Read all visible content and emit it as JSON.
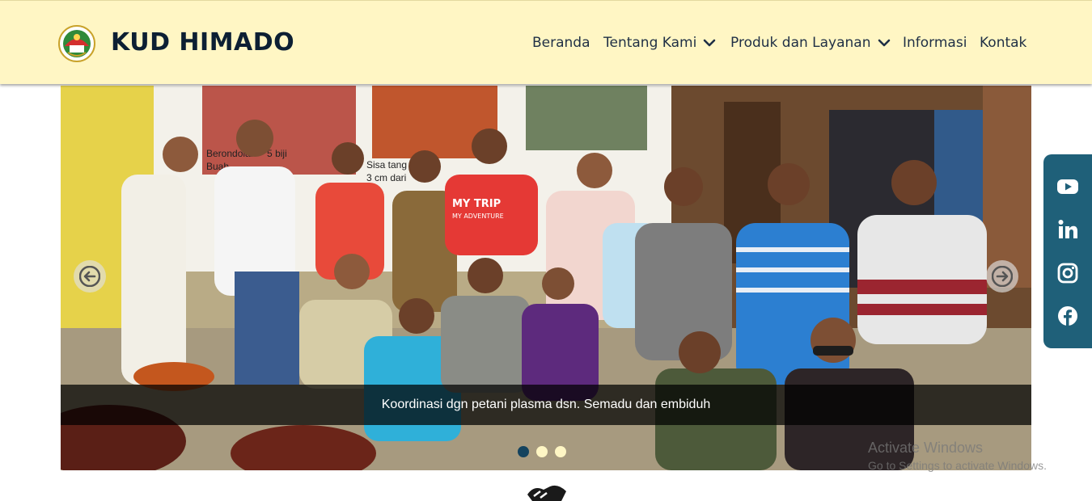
{
  "brand": {
    "name": "KUD HIMADO",
    "logo": "cooperative-logo"
  },
  "nav": {
    "items": [
      {
        "label": "Beranda",
        "has_dropdown": false
      },
      {
        "label": "Tentang Kami",
        "has_dropdown": true,
        "icon": "chevron-down-icon"
      },
      {
        "label": "Produk dan Layanan",
        "has_dropdown": true,
        "icon": "chevron-down-icon"
      },
      {
        "label": "Informasi",
        "has_dropdown": false
      },
      {
        "label": "Kontak",
        "has_dropdown": false
      }
    ]
  },
  "slider": {
    "caption": "Koordinasi dgn petani plasma dsn. Semadu dan embiduh",
    "prev_icon": "arrow-left-icon",
    "next_icon": "arrow-right-icon",
    "slide_count": 3,
    "active_index": 0,
    "banner_text": [
      "Berondolan > 5 biji",
      "Buah",
      "Sisa tang",
      "3 cm dari",
      "MY TRIP",
      "MY ADVENTURE"
    ]
  },
  "social": [
    {
      "name": "youtube-icon"
    },
    {
      "name": "linkedin-icon"
    },
    {
      "name": "instagram-icon"
    },
    {
      "name": "facebook-icon"
    }
  ],
  "watermark": {
    "title": "Activate Windows",
    "subtitle": "Go to Settings to activate Windows."
  },
  "colors": {
    "navbar": "#fff6c4",
    "brand_text": "#0c1f33",
    "social_bar": "#1f6079",
    "dot_active": "#14435e",
    "dot_inactive": "#fff6c4"
  }
}
